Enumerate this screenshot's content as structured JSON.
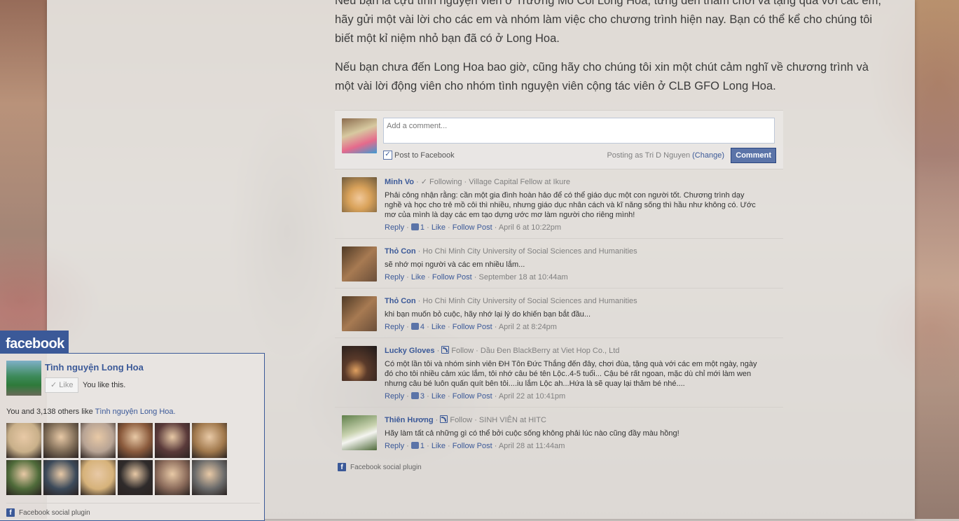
{
  "intro": {
    "paragraph_1_lines": [
      "Nếu bạn là cựu tình nguyện viên ở Trường Mồ Côi Long Hoa, từng đến thăm chơi và tặng quà với các em,",
      "hãy gửi một vài lời cho các em và nhóm làm việc cho chương trình hiện nay. Bạn có thể kể cho chúng tôi",
      "biết một kỉ niệm nhỏ bạn đã có ở Long Hoa."
    ],
    "paragraph_2_lines": [
      "Nếu bạn chưa đến Long Hoa bao giờ, cũng hãy cho chúng tôi xin một chút cảm nghĩ về chương trình và",
      "một vài lời động viên cho nhóm tình nguyện viên cộng tác viên ở CLB GFO Long Hoa."
    ]
  },
  "compose": {
    "placeholder": "Add a comment...",
    "post_to_facebook": "Post to Facebook",
    "posting_as": "Posting as Tri D Nguyen",
    "change_link": "(Change)",
    "comment_button": "Comment"
  },
  "comments": [
    {
      "name": "Minh Vo",
      "status": "Following",
      "meta": "Village Capital Fellow at Ikure",
      "text": "Phải công nhận rằng: cần một gia đình hoàn hảo để có thể giáo dục một con người tốt. Chương trình dạy nghề và học cho trẻ mồ côi thì nhiều, nhưng giáo dục nhân cách và kĩ năng sống thì hầu như không có. Ước mơ của mình là dạy các em tạo dựng ước mơ làm người cho riêng mình!",
      "reply": "Reply",
      "likes": "1",
      "like": "Like",
      "follow": "Follow Post",
      "date": "April 6 at 10:22pm",
      "avatar_color": "#d9a25a"
    },
    {
      "name": "Thỏ Con",
      "meta": "Ho Chi Minh City University of Social Sciences and Humanities",
      "text": "sẽ nhớ mọi người và các em nhiều lắm...",
      "reply": "Reply",
      "likes": "",
      "like": "Like",
      "follow": "Follow Post",
      "date": "September 18 at 10:44am",
      "avatar_color": "#7a5a3c"
    },
    {
      "name": "Thỏ Con",
      "meta": "Ho Chi Minh City University of Social Sciences and Humanities",
      "text": "khi bạn muốn bỏ cuộc, hãy nhớ lại lý do khiến bạn bắt đầu...",
      "reply": "Reply",
      "likes": "4",
      "like": "Like",
      "follow": "Follow Post",
      "date": "April 2 at 8:24pm",
      "avatar_color": "#7a5a3c"
    },
    {
      "name": "Lucky Gloves",
      "status": "Follow",
      "meta": "Dầu Đen BlackBerry at Viet Hop Co., Ltd",
      "text": "Có một lần tôi và nhóm sinh viên ĐH Tôn Đức Thắng đến đây, chơi đùa, tặng quà với các em một ngày, ngày đó cho tôi nhiều cảm xúc lắm, tôi nhớ câu bé tên Lộc..4-5 tuổi... Cậu bé rất ngoan, mặc dù chỉ mới làm wen nhưng câu bé luôn quấn quít bên tôi....iu lắm Lộc ah...Hứa là sẽ quay lại thăm bé nhé....",
      "reply": "Reply",
      "likes": "3",
      "like": "Like",
      "follow": "Follow Post",
      "date": "April 22 at 10:41pm",
      "avatar_color": "#3d2a25"
    },
    {
      "name": "Thiên Hương",
      "status": "Follow",
      "meta": "SINH VIÊN at HITC",
      "text": "Hãy làm tất cả những gì có thể bởi cuộc sống không phải lúc nào cũng đầy màu hồng!",
      "reply": "Reply",
      "likes": "1",
      "like": "Like",
      "follow": "Follow Post",
      "date": "April 28 at 11:44am",
      "avatar_color": "#6e8a5a"
    }
  ],
  "plugin_footer": "Facebook social plugin",
  "likebox": {
    "brand": "facebook",
    "page_name": "Tình nguyện Long Hoa",
    "like_button": "Like",
    "you_like": "You like this.",
    "count_prefix": "You and 3,138 others like",
    "count_page": "Tình nguyện Long Hoa.",
    "footer": "Facebook social plugin",
    "faces": [
      "#c9b08a",
      "#7c6a55",
      "#b7a394",
      "#8a5a3c",
      "#5a3a3a",
      "#a0784c",
      "#4f6b3a",
      "#3c4a5a",
      "#d6b27a",
      "#2f2b2b",
      "#8a6a5a",
      "#6a6a6a"
    ]
  },
  "colors": {
    "facebook_blue": "#3b5998",
    "button_blue": "#5b74a8"
  }
}
